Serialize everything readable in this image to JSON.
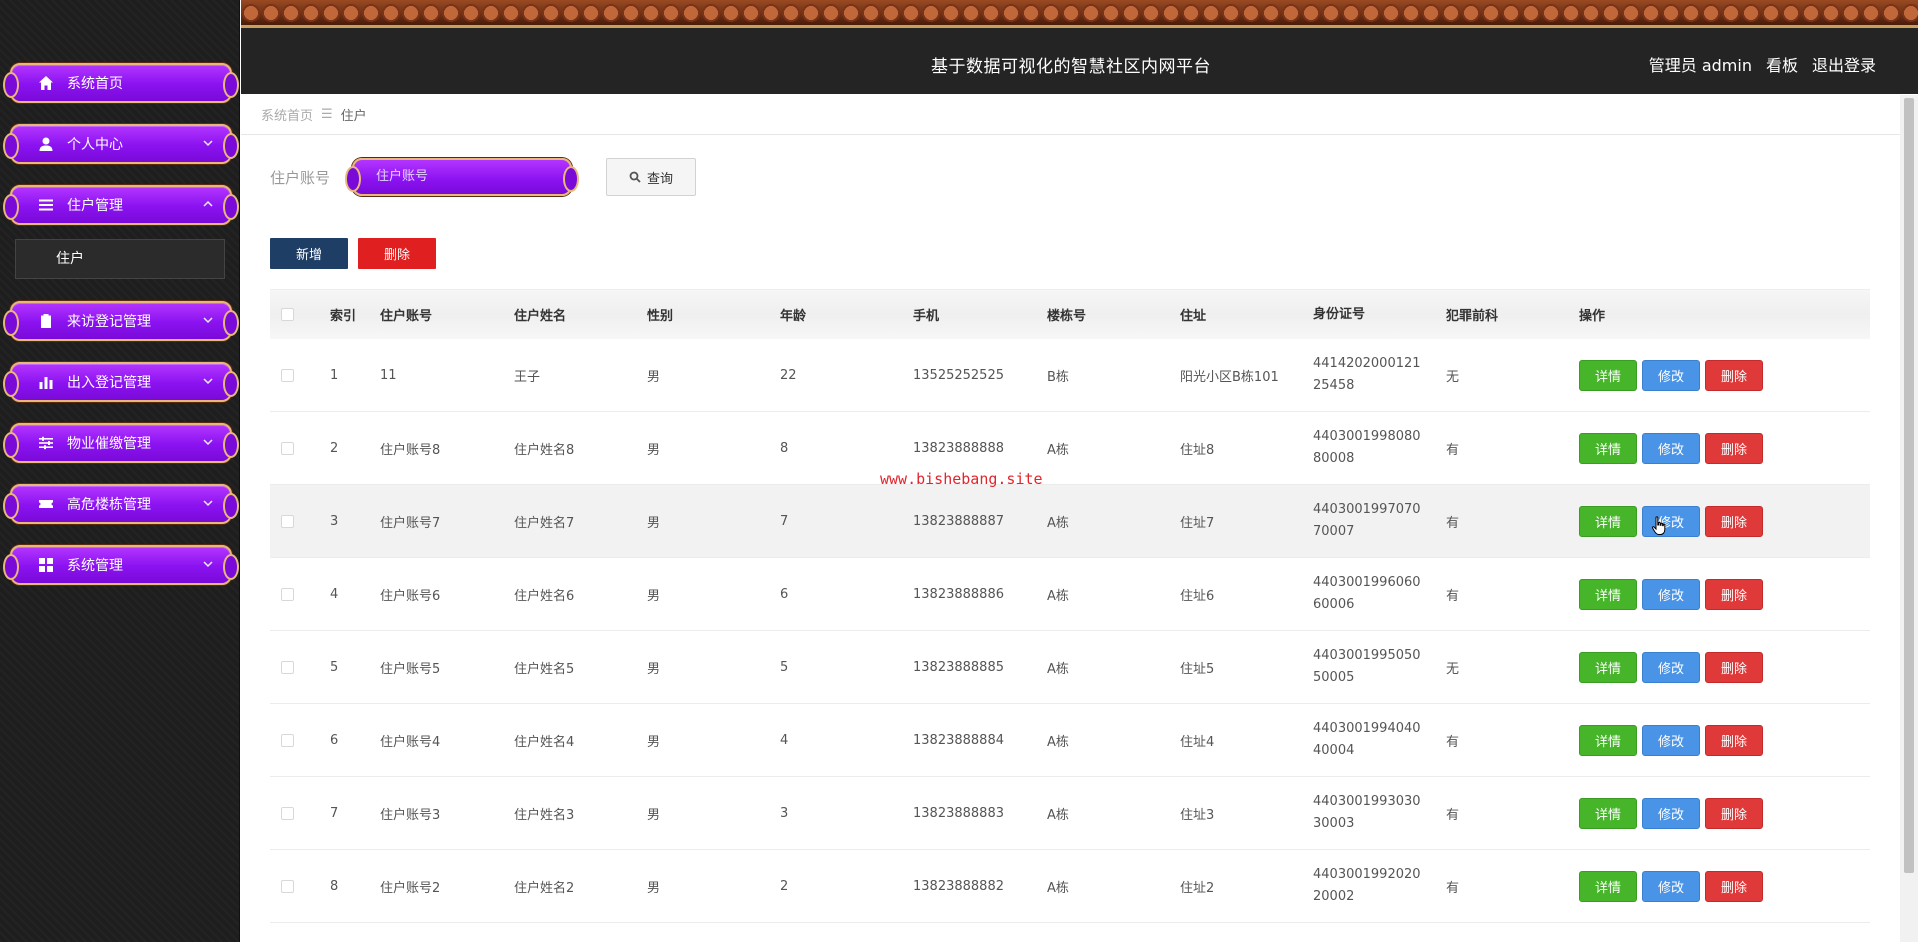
{
  "header": {
    "title": "基于数据可视化的智慧社区内网平台",
    "user": "管理员 admin",
    "dashboard_link": "看板",
    "logout_link": "退出登录"
  },
  "sidebar": {
    "items": [
      {
        "label": "系统首页",
        "icon": "home-icon"
      },
      {
        "label": "个人中心",
        "icon": "user-icon"
      },
      {
        "label": "住户管理",
        "icon": "list-icon"
      },
      {
        "label": "来访登记管理",
        "icon": "clipboard-icon"
      },
      {
        "label": "出入登记管理",
        "icon": "bar-chart-icon"
      },
      {
        "label": "物业催缴管理",
        "icon": "sliders-icon"
      },
      {
        "label": "高危楼栋管理",
        "icon": "ticket-icon"
      },
      {
        "label": "系统管理",
        "icon": "grid-icon"
      }
    ],
    "sub_item": "住户"
  },
  "breadcrumb": {
    "home": "系统首页",
    "separator": "☰",
    "current": "住户"
  },
  "search": {
    "label": "住户账号",
    "placeholder": "住户账号",
    "button": "查询"
  },
  "actions": {
    "add": "新增",
    "delete": "删除"
  },
  "table": {
    "headers": [
      "索引",
      "住户账号",
      "住户姓名",
      "性别",
      "年龄",
      "手机",
      "楼栋号",
      "住址",
      "身份证号",
      "犯罪前科",
      "操作"
    ],
    "row_buttons": {
      "detail": "详情",
      "edit": "修改",
      "remove": "删除"
    },
    "rows": [
      {
        "idx": "1",
        "account": "11",
        "name": "王子",
        "gender": "男",
        "age": "22",
        "phone": "13525252525",
        "building": "B栋",
        "address": "阳光小区B栋101",
        "id_line1": "4414202000121",
        "id_line2": "25458",
        "record": "无"
      },
      {
        "idx": "2",
        "account": "住户账号8",
        "name": "住户姓名8",
        "gender": "男",
        "age": "8",
        "phone": "13823888888",
        "building": "A栋",
        "address": "住址8",
        "id_line1": "4403001998080",
        "id_line2": "80008",
        "record": "有"
      },
      {
        "idx": "3",
        "account": "住户账号7",
        "name": "住户姓名7",
        "gender": "男",
        "age": "7",
        "phone": "13823888887",
        "building": "A栋",
        "address": "住址7",
        "id_line1": "4403001997070",
        "id_line2": "70007",
        "record": "有"
      },
      {
        "idx": "4",
        "account": "住户账号6",
        "name": "住户姓名6",
        "gender": "男",
        "age": "6",
        "phone": "13823888886",
        "building": "A栋",
        "address": "住址6",
        "id_line1": "4403001996060",
        "id_line2": "60006",
        "record": "有"
      },
      {
        "idx": "5",
        "account": "住户账号5",
        "name": "住户姓名5",
        "gender": "男",
        "age": "5",
        "phone": "13823888885",
        "building": "A栋",
        "address": "住址5",
        "id_line1": "4403001995050",
        "id_line2": "50005",
        "record": "无"
      },
      {
        "idx": "6",
        "account": "住户账号4",
        "name": "住户姓名4",
        "gender": "男",
        "age": "4",
        "phone": "13823888884",
        "building": "A栋",
        "address": "住址4",
        "id_line1": "4403001994040",
        "id_line2": "40004",
        "record": "有"
      },
      {
        "idx": "7",
        "account": "住户账号3",
        "name": "住户姓名3",
        "gender": "男",
        "age": "3",
        "phone": "13823888883",
        "building": "A栋",
        "address": "住址3",
        "id_line1": "4403001993030",
        "id_line2": "30003",
        "record": "有"
      },
      {
        "idx": "8",
        "account": "住户账号2",
        "name": "住户姓名2",
        "gender": "男",
        "age": "2",
        "phone": "13823888882",
        "building": "A栋",
        "address": "住址2",
        "id_line1": "4403001992020",
        "id_line2": "20002",
        "record": "有"
      }
    ]
  },
  "watermark": "www.bishebang.site",
  "colors": {
    "menu_purple": "#8a12f0",
    "menu_border": "#e8b87a",
    "add_button": "#1f3e66",
    "delete_button": "#e02020",
    "detail_green": "#46b52a",
    "edit_blue": "#4a94e8",
    "remove_red": "#e0393a"
  }
}
